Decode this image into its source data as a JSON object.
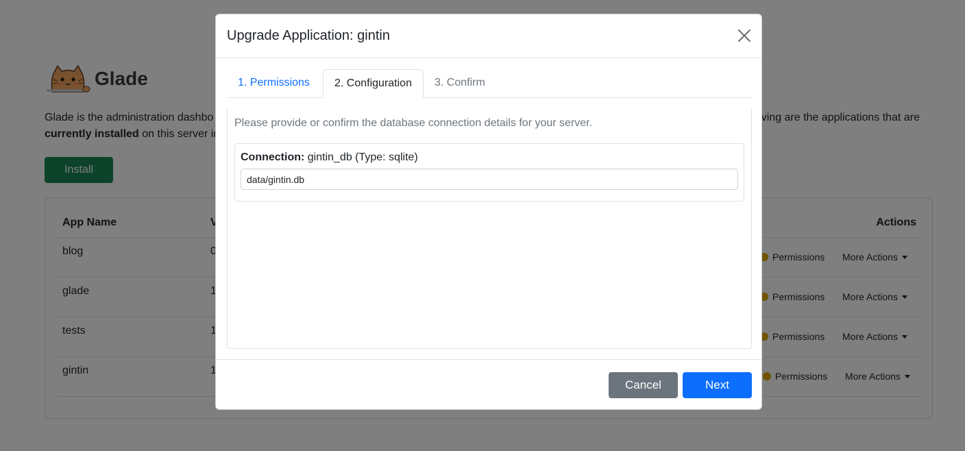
{
  "brand": {
    "name": "Glade",
    "logo_icon": "cat-logo-icon"
  },
  "intro": {
    "line1_start": "Glade is the administration dashbo",
    "line1_end": "ving are the applications that are",
    "bold": "currently installed",
    "line2_rest": " on this server ins"
  },
  "install_label": "Install",
  "apps_table": {
    "headers": {
      "name": "App Name",
      "version_partial": "V",
      "actions": "Actions"
    },
    "rows": [
      {
        "name": "blog",
        "version_partial": "0",
        "permissions": "Permissions",
        "more": "More Actions"
      },
      {
        "name": "glade",
        "version_partial": "1",
        "permissions": "Permissions",
        "more": "More Actions"
      },
      {
        "name": "tests",
        "version_partial": "1",
        "permissions": "Permissions",
        "more": "More Actions"
      },
      {
        "name": "gintin",
        "version_partial": "1",
        "permissions": "Permissions",
        "more": "More Actions"
      }
    ],
    "permission_dot_color": "#e0a800"
  },
  "modal": {
    "title": "Upgrade Application: gintin",
    "close_icon": "close-icon",
    "tabs": [
      {
        "label": "1. Permissions"
      },
      {
        "label": "2. Configuration"
      },
      {
        "label": "3. Confirm"
      }
    ],
    "active_tab": "2. Configuration",
    "description": "Please provide or confirm the database connection details for your server.",
    "connection": {
      "label": "Connection:",
      "detail": " gintin_db (Type: sqlite)",
      "value": "data/gintin.db"
    },
    "cancel_label": "Cancel",
    "next_label": "Next"
  },
  "colors": {
    "primary": "#0d6efd",
    "secondary": "#6c757d",
    "success": "#198754",
    "backdrop": "rgba(0,0,0,0.5)"
  }
}
